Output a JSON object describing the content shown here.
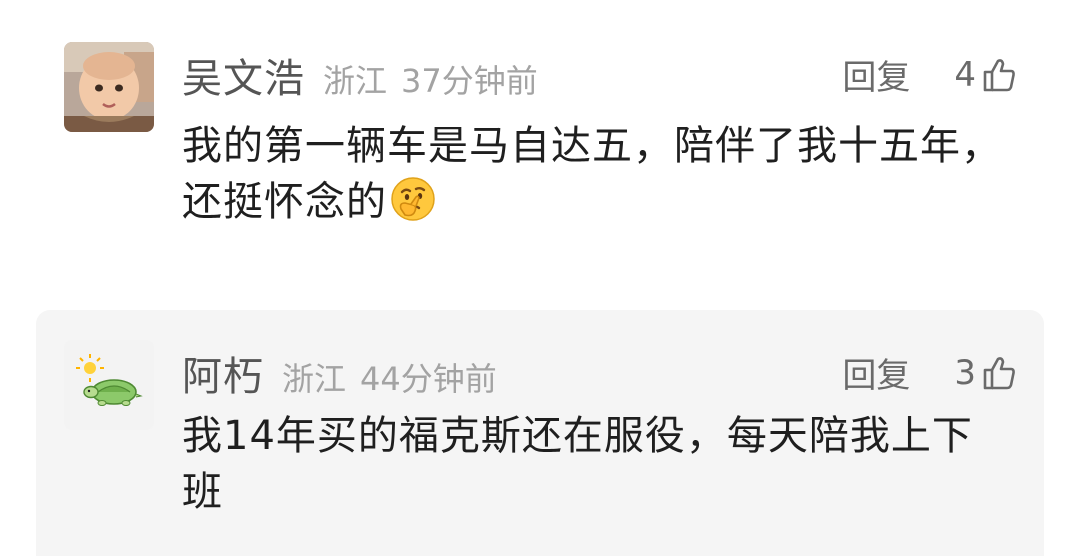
{
  "comments": [
    {
      "username": "吴文浩",
      "location": "浙江",
      "time": "37分钟前",
      "reply_label": "回复",
      "likes": "4",
      "text": "我的第一辆车是马自达五，陪伴了我十五年，还挺怀念的",
      "emoji": "thinking-face-emoji",
      "avatar": "child-monk-avatar"
    },
    {
      "username": "阿朽",
      "location": "浙江",
      "time": "44分钟前",
      "reply_label": "回复",
      "likes": "3",
      "text": "我14年买的福克斯还在服役，每天陪我上下班",
      "avatar": "turtle-avatar"
    }
  ],
  "colors": {
    "username": "#555555",
    "meta": "#a3a3a3",
    "body_text": "#1f1f1f",
    "reply_bg": "#f5f5f5"
  },
  "icons": [
    "thumbs-up-icon",
    "thinking-face-emoji"
  ]
}
